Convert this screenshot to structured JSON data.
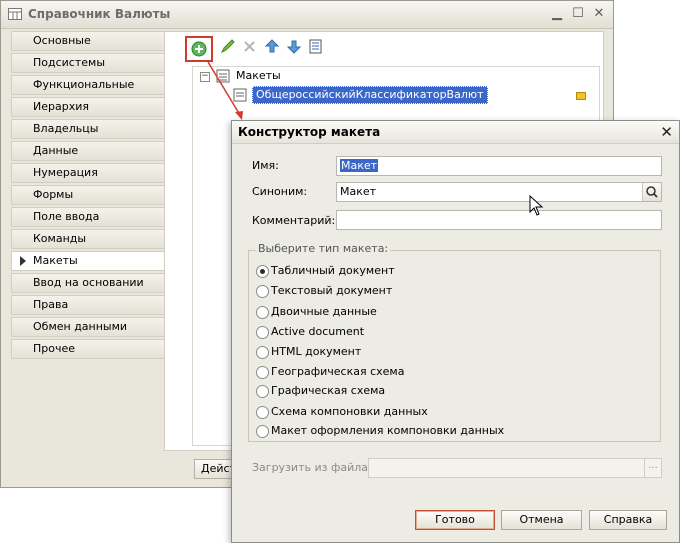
{
  "main_window": {
    "title": "Справочник Валюты",
    "sidebar_items": [
      {
        "label": "Основные"
      },
      {
        "label": "Подсистемы"
      },
      {
        "label": "Функциональные опции"
      },
      {
        "label": "Иерархия"
      },
      {
        "label": "Владельцы"
      },
      {
        "label": "Данные"
      },
      {
        "label": "Нумерация"
      },
      {
        "label": "Формы"
      },
      {
        "label": "Поле ввода"
      },
      {
        "label": "Команды"
      },
      {
        "label": "Макеты"
      },
      {
        "label": "Ввод на основании"
      },
      {
        "label": "Права"
      },
      {
        "label": "Обмен данными"
      },
      {
        "label": "Прочее"
      }
    ],
    "active_sidebar_item": "Макеты",
    "tree": {
      "root_label": "Макеты",
      "child_label": "ОбщероссийскийКлассификаторВалют"
    },
    "actions_button_label": "Дейст",
    "toolbar_icons": [
      "add-icon",
      "edit-icon",
      "delete-icon",
      "move-up-icon",
      "move-down-icon",
      "list-icon"
    ],
    "colors": {
      "highlight_box": "#d13b2c",
      "selection": "#3a67c9"
    }
  },
  "dialog": {
    "title": "Конструктор макета",
    "name_label": "Имя:",
    "name_value": "Макет",
    "synonym_label": "Синоним:",
    "synonym_value": "Макет",
    "comment_label": "Комментарий:",
    "comment_value": "",
    "type_group_caption": "Выберите тип макета:",
    "types": [
      {
        "label": "Табличный документ",
        "selected": true
      },
      {
        "label": "Текстовый документ",
        "selected": false
      },
      {
        "label": "Двоичные данные",
        "selected": false
      },
      {
        "label": "Active document",
        "selected": false
      },
      {
        "label": "HTML документ",
        "selected": false
      },
      {
        "label": "Географическая схема",
        "selected": false
      },
      {
        "label": "Графическая схема",
        "selected": false
      },
      {
        "label": "Схема компоновки данных",
        "selected": false
      },
      {
        "label": "Макет оформления компоновки данных",
        "selected": false
      }
    ],
    "load_from_file_label": "Загрузить из файла:",
    "load_button_label": "...",
    "buttons": {
      "ok": "Готово",
      "cancel": "Отмена",
      "help": "Справка"
    }
  }
}
